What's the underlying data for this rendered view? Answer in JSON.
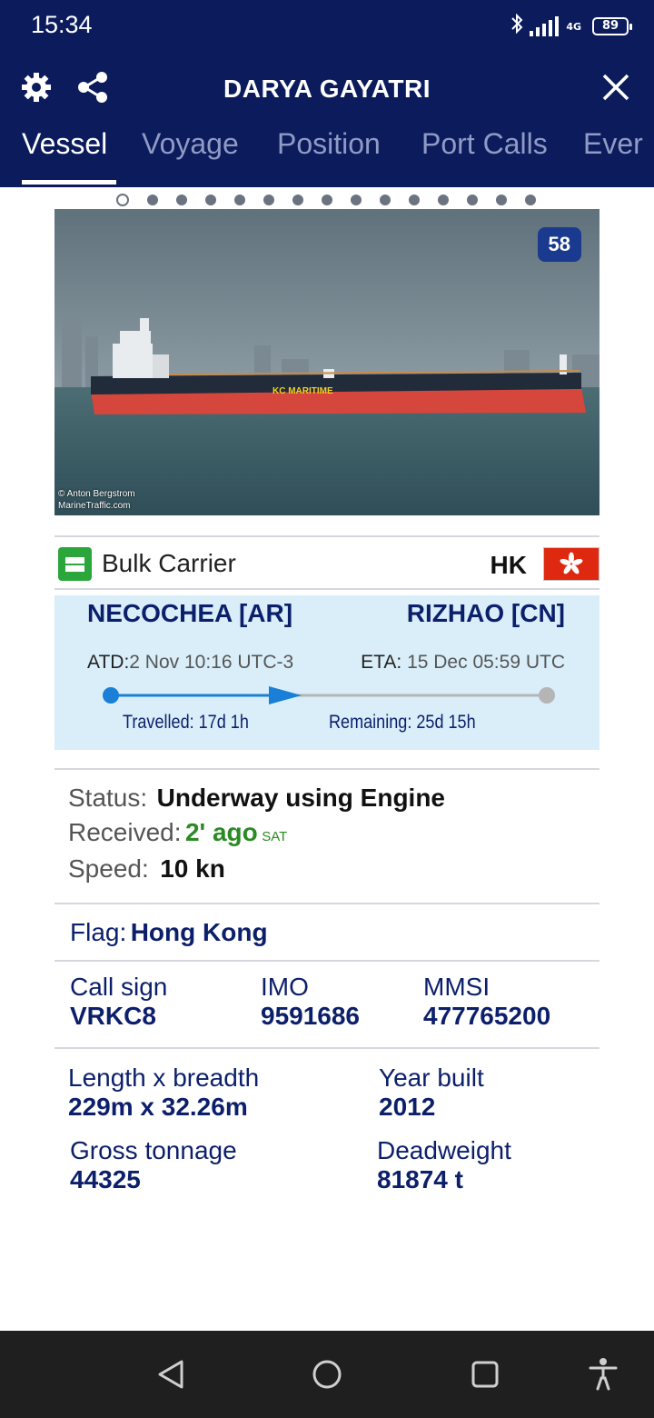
{
  "status_bar": {
    "time": "15:34",
    "network": "4G",
    "battery": "89",
    "icons": [
      "bluetooth-icon",
      "signal-icon",
      "battery-icon"
    ]
  },
  "header": {
    "title": "DARYA GAYATRI",
    "icons": [
      "gear-icon",
      "share-icon",
      "close-icon"
    ]
  },
  "tabs": [
    {
      "label": "Vessel",
      "active": true
    },
    {
      "label": "Voyage",
      "active": false
    },
    {
      "label": "Position",
      "active": false
    },
    {
      "label": "Port Calls",
      "active": false
    },
    {
      "label": "Ever",
      "active": false
    }
  ],
  "photo": {
    "count": "58",
    "credit_line1": "© Anton Bergstrom",
    "credit_line2": "MarineTraffic.com",
    "hull_text": "KC MARITIME",
    "pager_total": 15,
    "pager_current": 1
  },
  "vessel_type": {
    "type": "Bulk Carrier",
    "flag_code": "HK"
  },
  "voyage": {
    "from_port": "NECOCHEA [AR]",
    "to_port": "RIZHAO [CN]",
    "atd_label": "ATD:",
    "atd_value": "2 Nov 10:16 UTC-3",
    "eta_label": "ETA:",
    "eta_value": "15 Dec 05:59 UTC",
    "travelled": "Travelled: 17d 1h",
    "remaining": "Remaining: 25d 15h",
    "progress_fraction": 0.4
  },
  "status": {
    "status_label": "Status:",
    "status_value": "Underway using Engine",
    "received_label": "Received:",
    "received_value": "2' ago",
    "received_source": "SAT",
    "speed_label": "Speed:",
    "speed_value": "10 kn"
  },
  "flag": {
    "label": "Flag:",
    "value": "Hong Kong"
  },
  "ids": {
    "callsign_label": "Call sign",
    "callsign_value": "VRKC8",
    "imo_label": "IMO",
    "imo_value": "9591686",
    "mmsi_label": "MMSI",
    "mmsi_value": "477765200"
  },
  "dimensions": {
    "size_label": "Length x breadth",
    "size_value": "229m x 32.26m",
    "year_label": "Year built",
    "year_value": "2012",
    "gt_label": "Gross tonnage",
    "gt_value": "44325",
    "dwt_label": "Deadweight",
    "dwt_value": "81874 t"
  },
  "colors": {
    "header_bg": "#0b1b5c",
    "accent_blue": "#0c1f6b",
    "progress_blue": "#1a7fd6",
    "green": "#2a8a24",
    "voyage_bg": "#d9eef9"
  }
}
